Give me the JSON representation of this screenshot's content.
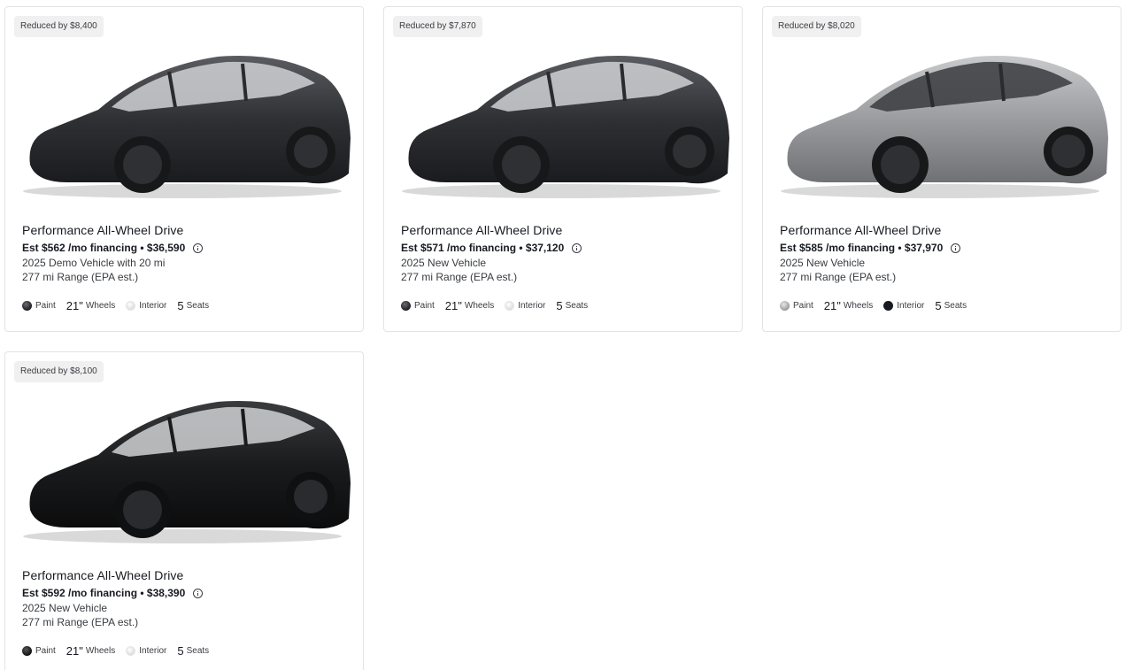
{
  "cards": [
    {
      "badge": "Reduced by $8,400",
      "title": "Performance All-Wheel Drive",
      "price": "Est $562 /mo financing • $36,590",
      "condition": "2025 Demo Vehicle with 20 mi",
      "range": "277 mi Range (EPA est.)",
      "paint_label": "Paint",
      "wheels_value": "21\"",
      "wheels_label": "Wheels",
      "interior_label": "Interior",
      "seats_value": "5",
      "seats_label": "Seats",
      "paint_color": "#2b2c2f",
      "interior_color": "#f2f2f2"
    },
    {
      "badge": "Reduced by $7,870",
      "title": "Performance All-Wheel Drive",
      "price": "Est $571 /mo financing • $37,120",
      "condition": "2025 New Vehicle",
      "range": "277 mi Range (EPA est.)",
      "paint_label": "Paint",
      "wheels_value": "21\"",
      "wheels_label": "Wheels",
      "interior_label": "Interior",
      "seats_value": "5",
      "seats_label": "Seats",
      "paint_color": "#2b2c2f",
      "interior_color": "#f2f2f2"
    },
    {
      "badge": "Reduced by $8,020",
      "title": "Performance All-Wheel Drive",
      "price": "Est $585 /mo financing • $37,970",
      "condition": "2025 New Vehicle",
      "range": "277 mi Range (EPA est.)",
      "paint_label": "Paint",
      "wheels_value": "21\"",
      "wheels_label": "Wheels",
      "interior_label": "Interior",
      "seats_value": "5",
      "seats_label": "Seats",
      "paint_color": "#9a9c9f",
      "interior_color": "#171a20"
    },
    {
      "badge": "Reduced by $8,100",
      "title": "Performance All-Wheel Drive",
      "price": "Est $592 /mo financing • $38,390",
      "condition": "2025 New Vehicle",
      "range": "277 mi Range (EPA est.)",
      "paint_label": "Paint",
      "wheels_value": "21\"",
      "wheels_label": "Wheels",
      "interior_label": "Interior",
      "seats_value": "5",
      "seats_label": "Seats",
      "paint_color": "#141414",
      "interior_color": "#f2f2f2"
    }
  ]
}
